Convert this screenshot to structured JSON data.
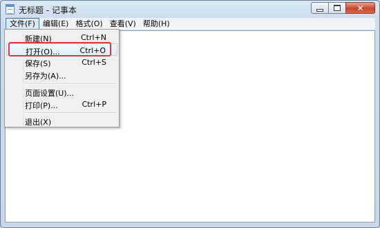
{
  "window": {
    "title": "无标题 - 记事本",
    "icons": {
      "app": "notepad-icon",
      "minimize": "minimize-icon",
      "maximize": "maximize-icon",
      "close": "close-icon"
    },
    "close_glyph": "✕"
  },
  "menubar": {
    "items": [
      {
        "label": "文件(F)",
        "active": true
      },
      {
        "label": "编辑(E)"
      },
      {
        "label": "格式(O)"
      },
      {
        "label": "查看(V)"
      },
      {
        "label": "帮助(H)"
      }
    ]
  },
  "file_menu": {
    "items": [
      {
        "label": "新建(N)",
        "shortcut": "Ctrl+N"
      },
      {
        "label": "打开(O)...",
        "shortcut": "Ctrl+O",
        "highlighted": true
      },
      {
        "label": "保存(S)",
        "shortcut": "Ctrl+S"
      },
      {
        "label": "另存为(A)...",
        "shortcut": ""
      },
      {
        "label": "页面设置(U)...",
        "shortcut": ""
      },
      {
        "label": "打印(P)...",
        "shortcut": "Ctrl+P"
      },
      {
        "label": "退出(X)",
        "shortcut": ""
      }
    ]
  },
  "editor": {
    "content": ""
  },
  "colors": {
    "highlight_border": "#d33a44",
    "active_menu_border": "#3c6ea5"
  }
}
